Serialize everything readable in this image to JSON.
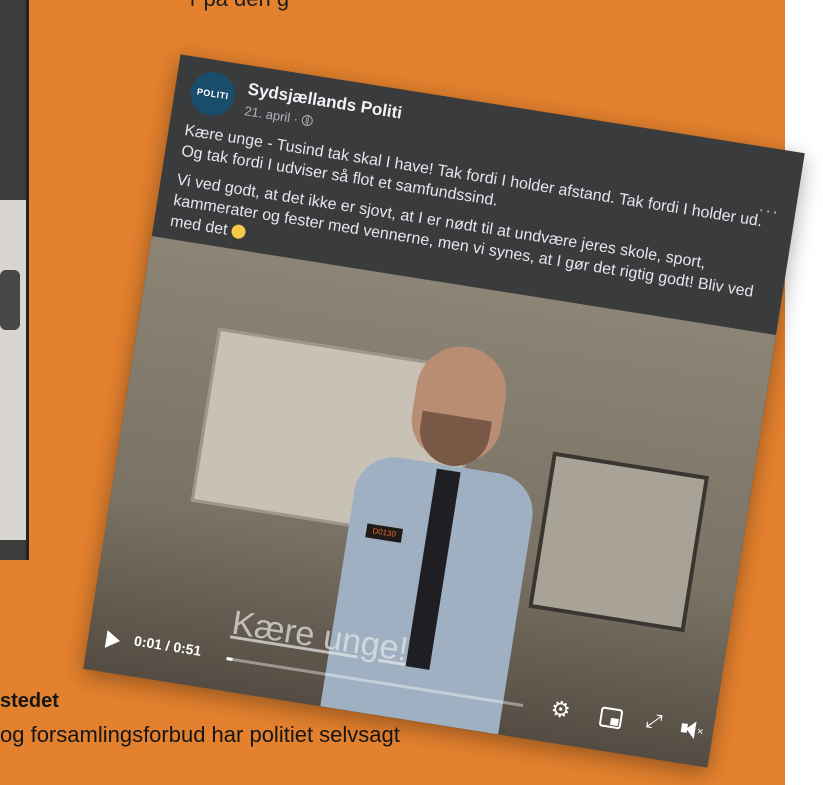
{
  "background": {
    "top_text": "r   på   den    g",
    "article": {
      "heading": "stedet",
      "body": "og forsamlingsforbud har politiet selvsagt"
    }
  },
  "post": {
    "page_name": "Sydsjællands Politi",
    "avatar_text": "POLITI",
    "date": "21. april ·",
    "more": "···",
    "paragraph1": "Kære unge - Tusind tak skal I have! Tak fordi I holder afstand. Tak fordi I holder ud. Og tak fordi I udviser så flot et samfundssind.",
    "paragraph2": "Vi ved godt, at det ikke er sjovt, at I er nødt til at undvære jeres skole, sport, kammerater og fester med vennerne, men vi synes, at I gør det rigtig godt! Bliv ved med det"
  },
  "video": {
    "caption": "Kære unge!",
    "badge": "D0130",
    "current_time": "0:01",
    "duration": "0:51",
    "time_display": "0:01 / 0:51",
    "progress_fraction": 0.02
  },
  "colors": {
    "background_orange": "#e3812e",
    "post_background": "#3a3b3c"
  },
  "icons": [
    "globe-icon",
    "more-icon",
    "smiley-icon",
    "play-icon",
    "gear-icon",
    "pip-icon",
    "expand-icon",
    "mute-icon"
  ]
}
